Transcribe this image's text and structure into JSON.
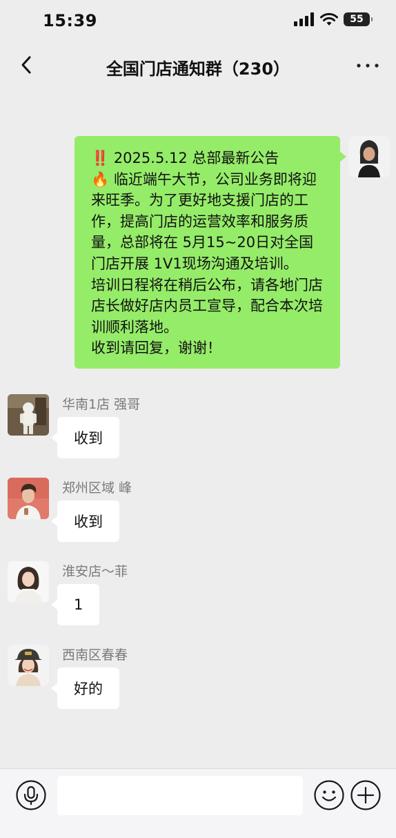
{
  "status_bar": {
    "time": "15:39",
    "battery": "55"
  },
  "header": {
    "title": "全国门店通知群（230）"
  },
  "announcement": {
    "text": "‼️ 2025.5.12 总部最新公告\n🔥 临近端午大节，公司业务即将迎来旺季。为了更好地支援门店的工作，提高门店的运营效率和服务质量，总部将在 5月15~20日对全国门店开展 1V1现场沟通及培训。\n培训日程将在稍后公布，请各地门店店长做好店内员工宣导，配合本次培训顺利落地。\n收到请回复，谢谢！"
  },
  "messages": [
    {
      "sender": "华南1店 强哥",
      "text": "收到"
    },
    {
      "sender": "郑州区域 峰",
      "text": "收到"
    },
    {
      "sender": "淮安店～菲",
      "text": "1"
    },
    {
      "sender": "西南区春春",
      "text": "好的"
    }
  ],
  "input": {
    "value": "",
    "placeholder": ""
  },
  "icons": {
    "back": "chevron-left-icon",
    "more": "more-dots-icon",
    "voice": "microphone-icon",
    "emoji": "smiley-icon",
    "plus": "plus-icon"
  },
  "colors": {
    "background": "#ededed",
    "my_bubble": "#95ec69",
    "other_bubble": "#ffffff",
    "sender_name": "#7a7a7a"
  }
}
